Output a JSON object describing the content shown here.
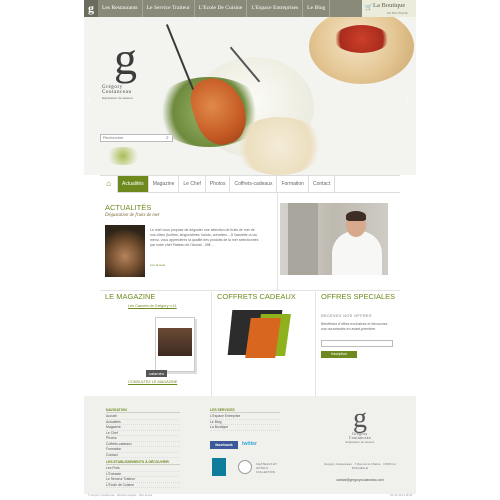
{
  "topnav": {
    "items": [
      "Les Restaurants",
      "Le Service Traiteur",
      "L'Ecole De Cuisine",
      "L'Espace Entreprises",
      "Le Blog"
    ],
    "boutique": "La Boutique",
    "boutique_sub": "EN BOUTIQUE"
  },
  "hero": {
    "brand_letter": "g",
    "brand_name1": "Grégory",
    "brand_name2": "Coutanceau",
    "brand_tag": "Explorateur de saveurs",
    "search_placeholder": "Rechercher"
  },
  "subnav": {
    "items": [
      "Actualités",
      "Magazine",
      "Le Chef",
      "Photos",
      "Coffrets-cadeaux",
      "Formation",
      "Contact"
    ]
  },
  "actualites": {
    "title": "ACTUALITÉS",
    "subtitle": "Dégustation de fruits de mer",
    "text": "Le chef vous propose de déguster une sélection de fruits de mer de nos côtes (huîtres, langoustines, bulots, crevettes... À l'assiette ou au menu, vous apprécierez la qualité des produits de la mer sélectionnés par notre chef Plateau de l'Amiral - 39€ ...",
    "more": "Lire la suite"
  },
  "magazine": {
    "title": "LE MAGAZINE",
    "link": "Les Carnets de Grégory n.11",
    "calameo": "calaméo",
    "consult": "CONSULTEZ LE MAGAZINE"
  },
  "coffrets": {
    "title": "COFFRETS CADEAUX"
  },
  "offres": {
    "title": "OFFRES SPECIALES",
    "newsletter": "RECEVEZ NOS OFFRES",
    "desc": "Bénéficiez d'offres exclusives et découvrez nos nouveautés en avant-première.",
    "button": "Inscription"
  },
  "footer": {
    "nav_head": "NAVIGATION",
    "nav_items": [
      "Accueil",
      "Actualités",
      "Magazine",
      "Le Chef",
      "Photos",
      "Coffrets-cadeaux",
      "Formation",
      "Contact"
    ],
    "etab_head": "LES ETABLISSEMENTS À DÉCOUVRIR",
    "etab_items": [
      "Les Flots",
      "L'Entracte",
      "Le Serveur Traiteur",
      "L'Ecole de Cuisine"
    ],
    "serv_head": "LES SERVICES",
    "serv_items": [
      "L'Espace Entreprise",
      "Le Blog",
      "La Boutique"
    ],
    "facebook": "facebook",
    "twitter": "twitter",
    "cuisine_label": "CHÂTEAUX ET HÔTELS COLLECTION",
    "logo_letter": "g",
    "logo_name1": "Grégory",
    "logo_name2": "Coutanceau",
    "logo_tag": "Explorateur de saveurs",
    "address": "Grégory Coutanceau · 7 Rue de la Chaîne · 17000 LA ROCHELLE",
    "email": "contact@gregorycoutanceau.com"
  },
  "bottom": {
    "left": "© Grégory Coutanceau · Mentions légales · Plan du site",
    "right": "Tél. 05 46 41 48 49"
  }
}
